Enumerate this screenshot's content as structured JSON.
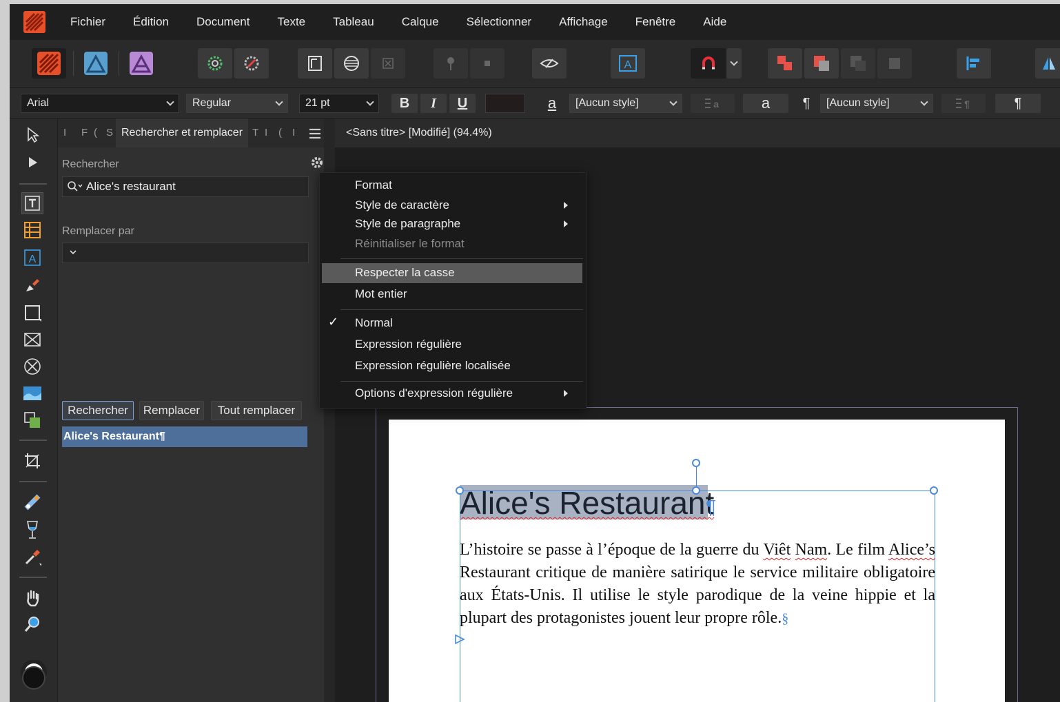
{
  "menubar": {
    "items": [
      "Fichier",
      "Édition",
      "Document",
      "Texte",
      "Tableau",
      "Calque",
      "Sélectionner",
      "Affichage",
      "Fenêtre",
      "Aide"
    ]
  },
  "context_bar": {
    "font_family": "Arial",
    "font_style": "Regular",
    "font_size": "21 pt",
    "bold_label": "B",
    "italic_label": "I",
    "underline_label": "U",
    "char_style_glyph": "a",
    "char_style": "[Aucun style]",
    "para_glyph": "¶",
    "para_style": "[Aucun style]"
  },
  "panel": {
    "tab_active": "Rechercher et remplacer",
    "tab_stubs_left": [
      "I",
      "F",
      "(",
      "S"
    ],
    "tab_stubs_right": [
      "T",
      "I",
      "(",
      "I"
    ],
    "search_label": "Rechercher",
    "search_value": "Alice's restaurant",
    "replace_label": "Remplacer par",
    "replace_value": "",
    "btn_find": "Rechercher",
    "btn_replace": "Remplacer",
    "btn_replace_all": "Tout remplacer",
    "result": "Alice's Restaurant¶"
  },
  "document": {
    "tab_title": "<Sans titre> [Modifié] (94.4%)",
    "heading": "Alice's Restaurant",
    "heading_pilcrow": "¶",
    "body_parts": {
      "p1": "L’histoire se passe à l’époque de la guerre du ",
      "viet": "Viêt",
      "sp": " ",
      "nam": "Nam",
      "p2": ". Le film ",
      "alices": "Alice’s",
      "p3": " Restaurant critique de manière satirique le service militaire obligatoire aux États-Unis. Il utilise le style parodique de la veine hippie et la plupart des protagonistes jouent leur propre rôle.",
      "end_mark": "§"
    }
  },
  "dropdown": {
    "items": {
      "format": "Format",
      "char_style": "Style de caractère",
      "para_style": "Style de paragraphe",
      "reset_format": "Réinitialiser le format",
      "match_case": "Respecter la casse",
      "whole_word": "Mot entier",
      "normal": "Normal",
      "regex": "Expression régulière",
      "regex_local": "Expression régulière localisée",
      "regex_options": "Options d'expression régulière"
    },
    "check_glyph": "✓"
  },
  "colors": {
    "accent": "#4a8ad8",
    "selection_row": "#4d6f99",
    "menu_highlight": "#5a5a5a",
    "app_icon": "#e8502a"
  }
}
